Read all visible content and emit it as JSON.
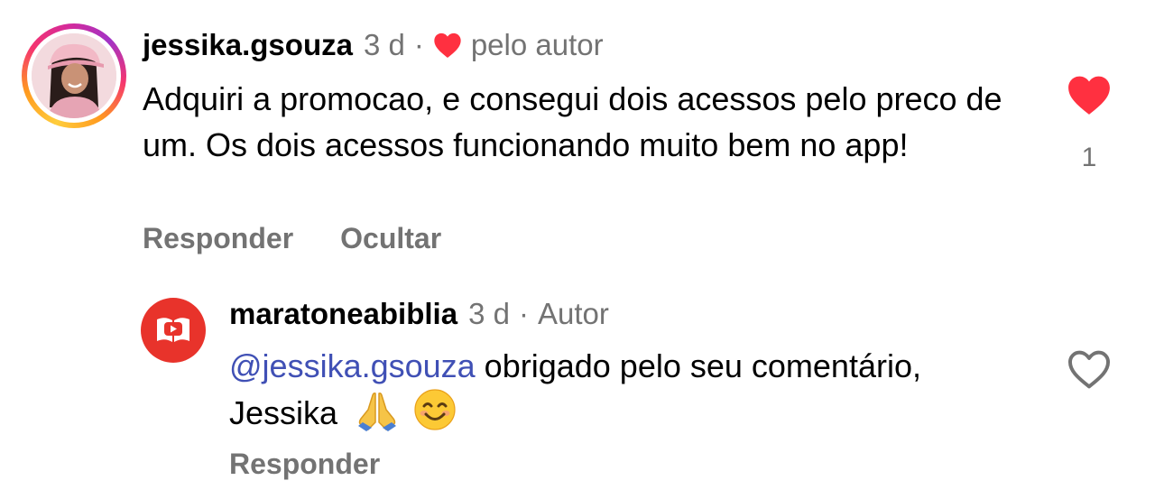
{
  "comment": {
    "username": "jessika.gsouza",
    "time": "3 d",
    "separator": "·",
    "author_like_label": "pelo autor",
    "text": "Adquiri a promocao, e consegui dois acessos pelo preco de um. Os dois acessos funcionando muito bem no app!",
    "like_count": "1",
    "liked": true,
    "actions": {
      "reply": "Responder",
      "hide": "Ocultar"
    },
    "avatar_icon": "profile-photo"
  },
  "reply": {
    "username": "maratoneabiblia",
    "time": "3 d",
    "separator": "·",
    "badge": "Autor",
    "mention": "@jessika.gsouza",
    "text": " obrigado pelo seu comentário, Jessika",
    "emojis": [
      "praying-hands-emoji",
      "smiling-face-emoji"
    ],
    "liked": false,
    "actions": {
      "reply": "Responder"
    },
    "avatar_icon": "book-play-logo"
  },
  "colors": {
    "heart_red": "#ff3040",
    "secondary_text": "#737373",
    "mention_blue": "#4050b5",
    "reply_avatar_red": "#e8332b"
  }
}
